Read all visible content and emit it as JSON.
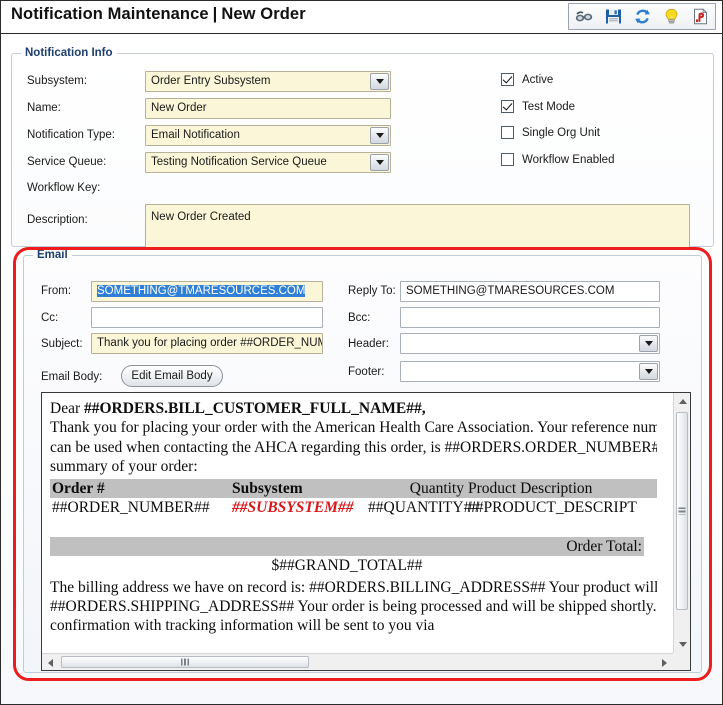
{
  "header": {
    "title_main": "Notification Maintenance",
    "separator": "|",
    "title_sub": "New Order",
    "toolbar": [
      {
        "name": "view-icon",
        "label": "View"
      },
      {
        "name": "save-icon",
        "label": "Save"
      },
      {
        "name": "refresh-icon",
        "label": "Refresh"
      },
      {
        "name": "hint-icon",
        "label": "Hint"
      },
      {
        "name": "report-icon",
        "label": "Report"
      }
    ]
  },
  "notification_info": {
    "legend": "Notification Info",
    "fields": {
      "subsystem_label": "Subsystem:",
      "subsystem_value": "Order Entry Subsystem",
      "name_label": "Name:",
      "name_value": "New Order",
      "notification_type_label": "Notification Type:",
      "notification_type_value": "Email Notification",
      "service_queue_label": "Service Queue:",
      "service_queue_value": "Testing Notification Service Queue",
      "workflow_key_label": "Workflow Key:",
      "workflow_key_value": "",
      "description_label": "Description:",
      "description_value": "New Order Created"
    },
    "checkboxes": [
      {
        "label": "Active",
        "checked": true
      },
      {
        "label": "Test Mode",
        "checked": true
      },
      {
        "label": "Single Org Unit",
        "checked": false
      },
      {
        "label": "Workflow Enabled",
        "checked": false
      }
    ]
  },
  "email": {
    "legend": "Email",
    "from_label": "From:",
    "from_value": "SOMETHING@TMARESOURCES.COM",
    "cc_label": "Cc:",
    "cc_value": "",
    "subject_label": "Subject:",
    "subject_value": "Thank you for placing order ##ORDER_NUMB",
    "email_body_label": "Email Body:",
    "edit_email_body_button": "Edit Email Body",
    "reply_to_label": "Reply To:",
    "reply_to_value": "SOMETHING@TMARESOURCES.COM",
    "bcc_label": "Bcc:",
    "bcc_value": "",
    "header_label": "Header:",
    "header_value": "",
    "footer_label": "Footer:",
    "footer_value": ""
  },
  "body_preview": {
    "greeting_prefix": "Dear ",
    "greeting_token": "##ORDERS.BILL_CUSTOMER_FULL_NAME##,",
    "paragraph1": "Thank you for placing your order with the American Health Care Association. Your reference number, which can be used when contacting the AHCA regarding this order, is ##ORDERS.ORDER_NUMBER##. Below is a summary of your order:",
    "table": {
      "headers": [
        "Order #",
        "Subsystem",
        "Quantity",
        "Product Description"
      ],
      "row": {
        "order_number": "##ORDER_NUMBER##",
        "subsystem": "##SUBSYSTEM##",
        "quantity": "##QUANTITY##",
        "product_description": "##PRODUCT_DESCRIPT"
      }
    },
    "order_total_label": "Order Total:",
    "order_total_value": "$##GRAND_TOTAL##",
    "paragraph2": "The billing address we have on record is: ##ORDERS.BILLING_ADDRESS## Your product will be shipped to: ##ORDERS.SHIPPING_ADDRESS## Your order is being processed and will be shipped shortly. A shipping confirmation with tracking information will be sent to you via"
  },
  "colors": {
    "highlight_ring": "#EE1C1C",
    "required_field_bg": "#FCF6D8",
    "selection_blue": "#2F7FD6",
    "token_red": "#D7191C",
    "legend_blue": "#1C3F6E"
  }
}
